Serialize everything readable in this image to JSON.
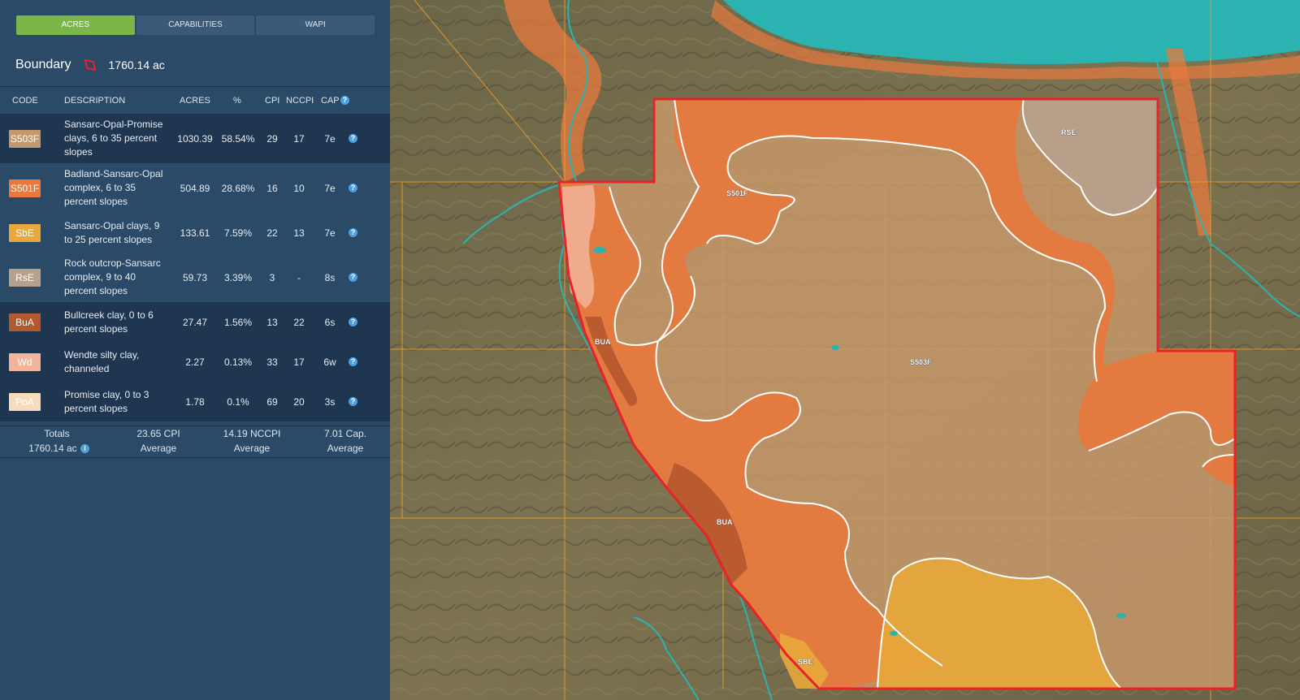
{
  "tabs": [
    {
      "label": "ACRES",
      "active": true
    },
    {
      "label": "CAPABILITIES",
      "active": false
    },
    {
      "label": "WAPI",
      "active": false
    }
  ],
  "boundary": {
    "label": "Boundary",
    "acres": "1760.14 ac"
  },
  "table": {
    "headers": {
      "code": "CODE",
      "description": "DESCRIPTION",
      "acres": "ACRES",
      "pct": "%",
      "cpi": "CPI",
      "nccpi": "NCCPI",
      "cap": "CAP"
    },
    "rows": [
      {
        "code": "S503F",
        "color": "#c5986a",
        "description": "Sansarc-Opal-Promise clays, 6 to 35 percent slopes",
        "acres": "1030.39",
        "pct": "58.54%",
        "cpi": "29",
        "nccpi": "17",
        "cap": "7e"
      },
      {
        "code": "S501F",
        "color": "#e8793d",
        "description": "Badland-Sansarc-Opal complex, 6 to 35 percent slopes",
        "acres": "504.89",
        "pct": "28.68%",
        "cpi": "16",
        "nccpi": "10",
        "cap": "7e"
      },
      {
        "code": "SbE",
        "color": "#e8a83a",
        "description": "Sansarc-Opal clays, 9 to 25 percent slopes",
        "acres": "133.61",
        "pct": "7.59%",
        "cpi": "22",
        "nccpi": "13",
        "cap": "7e"
      },
      {
        "code": "RsE",
        "color": "#b7a18d",
        "description": "Rock outcrop-Sansarc complex, 9 to 40 percent slopes",
        "acres": "59.73",
        "pct": "3.39%",
        "cpi": "3",
        "nccpi": "-",
        "cap": "8s"
      },
      {
        "code": "BuA",
        "color": "#b4582e",
        "description": "Bullcreek clay, 0 to 6 percent slopes",
        "acres": "27.47",
        "pct": "1.56%",
        "cpi": "13",
        "nccpi": "22",
        "cap": "6s"
      },
      {
        "code": "Wd",
        "color": "#f2b49a",
        "description": "Wendte silty clay, channeled",
        "acres": "2.27",
        "pct": "0.13%",
        "cpi": "33",
        "nccpi": "17",
        "cap": "6w"
      },
      {
        "code": "PoA",
        "color": "#f7dcbc",
        "description": "Promise clay, 0 to 3 percent slopes",
        "acres": "1.78",
        "pct": "0.1%",
        "cpi": "69",
        "nccpi": "20",
        "cap": "3s"
      }
    ]
  },
  "totals": {
    "label": "Totals",
    "acres": "1760.14 ac",
    "cpi": "23.65 CPI",
    "cpi_sub": "Average",
    "nccpi": "14.19 NCCPI",
    "nccpi_sub": "Average",
    "cap": "7.01 Cap.",
    "cap_sub": "Average"
  },
  "map": {
    "labels": {
      "rse": "RSE",
      "s501f": "S501F",
      "s503f": "S503F",
      "bua1": "BUA",
      "bua2": "BUA",
      "sbe": "SBE"
    },
    "colors": {
      "water": "#2bb3b1",
      "boundary": "#e8222a",
      "s503f": "#c5986a",
      "s501f": "#e8793d",
      "sbe": "#e8a83a",
      "rse": "#b7a18d",
      "bua": "#b4582e",
      "section_lines": "#f0a030"
    }
  }
}
